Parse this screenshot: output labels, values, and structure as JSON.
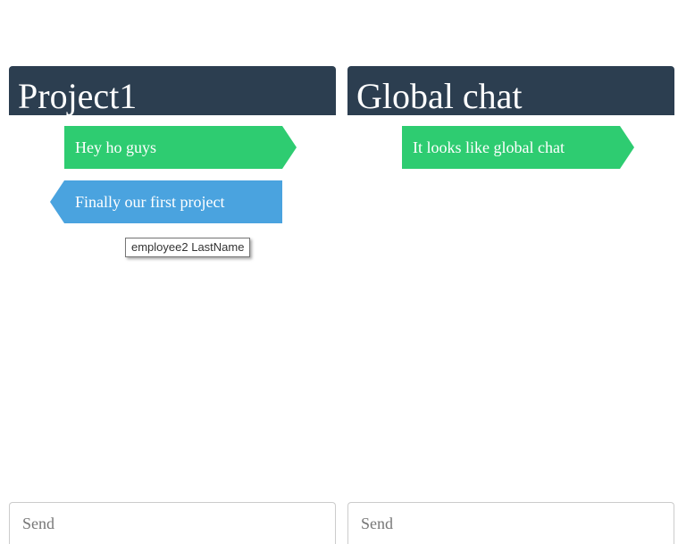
{
  "panels": [
    {
      "title": "Project1",
      "messages": [
        {
          "text": "Hey ho guys",
          "color": "#2ecc71",
          "side": "right"
        },
        {
          "text": "Finally our first project",
          "color": "#4aa3df",
          "side": "left"
        }
      ],
      "tooltip": "employee2 LastName",
      "input_placeholder": "Send"
    },
    {
      "title": "Global chat",
      "messages": [
        {
          "text": "It looks like global chat",
          "color": "#2ecc71",
          "side": "right"
        }
      ],
      "input_placeholder": "Send"
    }
  ],
  "colors": {
    "header_bg": "#2c3e50",
    "own_message": "#2ecc71",
    "other_message": "#4aa3df"
  }
}
